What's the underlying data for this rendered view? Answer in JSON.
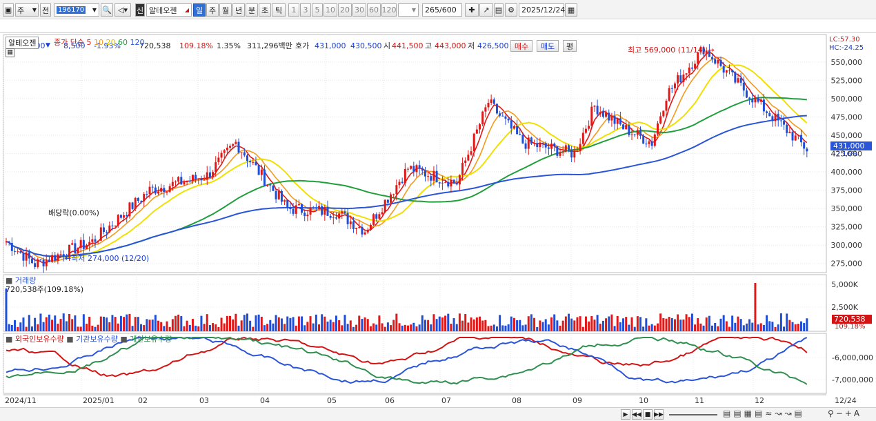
{
  "toolbar": {
    "period": "주",
    "prev": "전",
    "code": "196170",
    "stock_badge": "신",
    "name": "알테오젠",
    "tabs": [
      "일",
      "주",
      "월",
      "년",
      "분",
      "초",
      "틱"
    ],
    "active_tab": "일",
    "numbers": [
      "1",
      "3",
      "5",
      "10",
      "20",
      "30",
      "60",
      "120"
    ],
    "count": "265",
    "count_total": "/600",
    "date": "2025/12/24"
  },
  "quote": {
    "price": "431,000",
    "change": "8,500",
    "change_pct": "-1.93%",
    "volume": "720,538",
    "vol_ratio": "109.18%",
    "turnover_pct": "1.35%",
    "amount": "311,296백만",
    "bid_label": "호가",
    "bid1": "431,000",
    "bid2": "430,500",
    "open_label": "시",
    "open": "441,500",
    "high_label": "고",
    "high": "443,000",
    "low_label": "저",
    "low": "426,500",
    "buy_btn": "매수",
    "sell_btn": "매도",
    "flat_btn": "평"
  },
  "price_panel": {
    "name_tag": "알테오젠",
    "legend_prefix": "종가 단순",
    "ma_legend": [
      {
        "label": "5",
        "color": "#e01818"
      },
      {
        "label": "10",
        "color": "#f39a1c"
      },
      {
        "label": "20",
        "color": "#e8d800"
      },
      {
        "label": "60",
        "color": "#1f9e3c"
      },
      {
        "label": "120",
        "color": "#2a55d8"
      }
    ],
    "lc": "LC:57.30",
    "hc": "HC:-24.25",
    "high_annot": "최고 569,000 (11/14)",
    "low_annot": "최저 274,000 (12/20)",
    "dividend": "배당락(0.00%)",
    "current_tag": "431,000",
    "current_pct": "-2.16%",
    "y_ticks": [
      "550,000",
      "525,000",
      "500,000",
      "475,000",
      "450,000",
      "425,000",
      "400,000",
      "375,000",
      "350,000",
      "325,000",
      "300,000",
      "275,000"
    ]
  },
  "volume_panel": {
    "title": "거래량",
    "value_text": "720,538주(109.18%)",
    "y_ticks": [
      "5,000K",
      "2,500K"
    ],
    "tag": "720,538",
    "tag_pct": "109.18%"
  },
  "holding_panel": {
    "legend": [
      {
        "label": "외국인보유수량",
        "color": "#d21414"
      },
      {
        "label": "기관보유수량",
        "color": "#2a55d8"
      },
      {
        "label": "개인보유수량",
        "color": "#2f8f4f"
      }
    ],
    "y_ticks": [
      "-6,000,000",
      "-7,000,000"
    ]
  },
  "x_axis": {
    "labels": [
      "2024/11",
      "2025/01",
      "02",
      "03",
      "04",
      "05",
      "06",
      "07",
      "08",
      "09",
      "10",
      "11",
      "12"
    ],
    "right_label": "12/24"
  },
  "colors": {
    "up": "#e01818",
    "down": "#1f4fd8",
    "ma5": "#e01818",
    "ma10": "#f39a1c",
    "ma20": "#f0e000",
    "ma60": "#1f9e3c",
    "ma120": "#2a55d8"
  },
  "chart_data": {
    "type": "candlestick",
    "title": "알테오젠",
    "x_range": [
      "2024/11",
      "2025/12/24"
    ],
    "y_range": [
      262500,
      580000
    ],
    "close_series": [
      {
        "date": "2024/11",
        "close": 305000
      },
      {
        "date": "2024/12/20",
        "close": 274000
      },
      {
        "date": "2025/01",
        "close": 305000
      },
      {
        "date": "2025/02",
        "close": 375000
      },
      {
        "date": "2025/03",
        "close": 395000
      },
      {
        "date": "2025/03 mid",
        "close": 440000
      },
      {
        "date": "2025/04",
        "close": 350000
      },
      {
        "date": "2025/05",
        "close": 345000
      },
      {
        "date": "2025/05 end",
        "close": 320000
      },
      {
        "date": "2025/06",
        "close": 405000
      },
      {
        "date": "2025/07",
        "close": 385000
      },
      {
        "date": "2025/07 end",
        "close": 495000
      },
      {
        "date": "2025/08",
        "close": 440000
      },
      {
        "date": "2025/09",
        "close": 425000
      },
      {
        "date": "2025/09 mid",
        "close": 490000
      },
      {
        "date": "2025/10",
        "close": 460000
      },
      {
        "date": "2025/10 mid",
        "close": 440000
      },
      {
        "date": "2025/11",
        "close": 505000
      },
      {
        "date": "2025/11/14",
        "close": 569000
      },
      {
        "date": "2025/12",
        "close": 520000
      },
      {
        "date": "2025/12/24",
        "close": 431000
      }
    ],
    "volume_max": "5,000K",
    "ma_periods": [
      5,
      10,
      20,
      60,
      120
    ]
  }
}
